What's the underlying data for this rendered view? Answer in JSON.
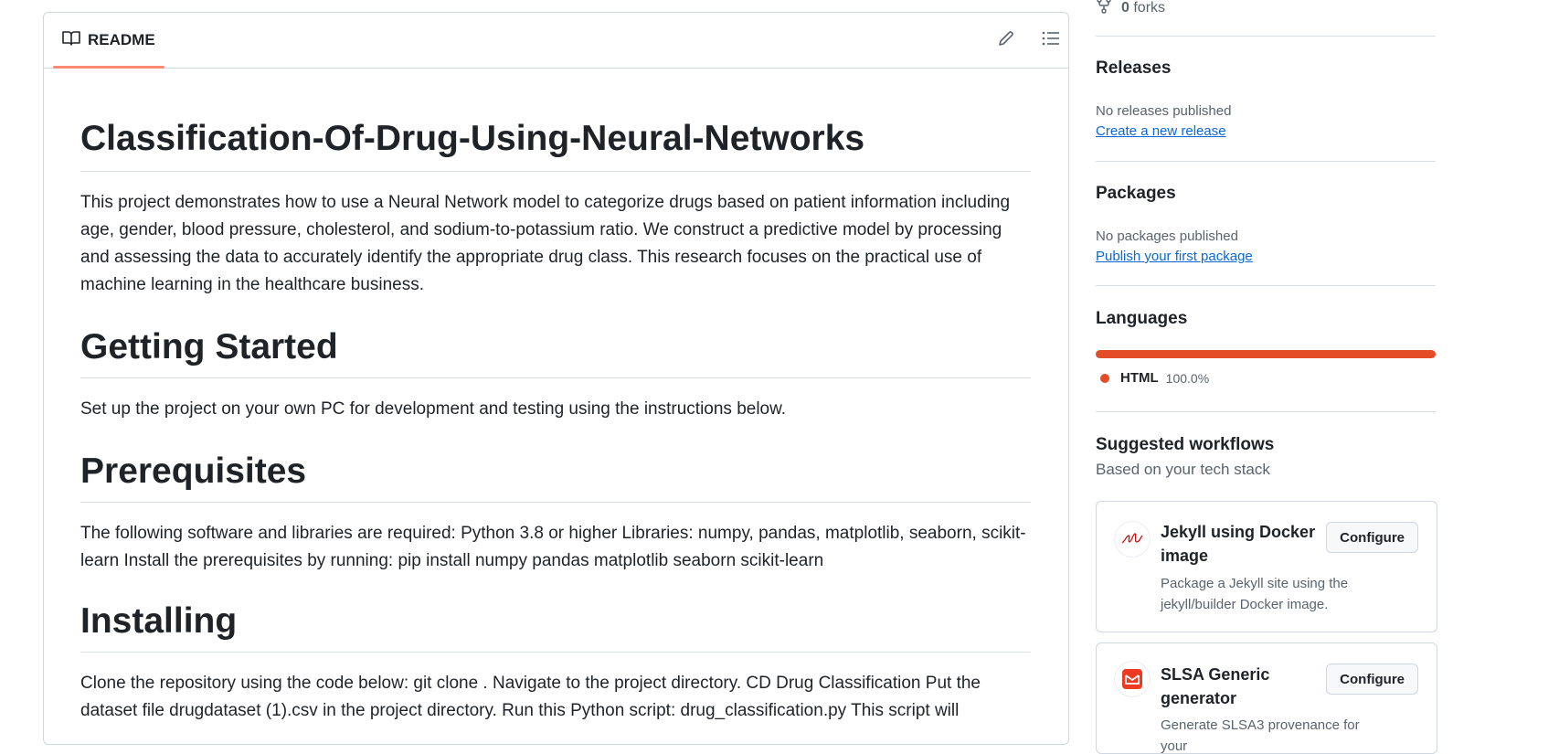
{
  "readme": {
    "tab_label": "README",
    "title": "Classification-Of-Drug-Using-Neural-Networks",
    "intro": "This project demonstrates how to use a Neural Network model to categorize drugs based on patient information including age, gender, blood pressure, cholesterol, and sodium-to-potassium ratio. We construct a predictive model by processing and assessing the data to accurately identify the appropriate drug class. This research focuses on the practical use of machine learning in the healthcare business.",
    "sections": [
      {
        "heading": "Getting Started",
        "text": "Set up the project on your own PC for development and testing using the instructions below."
      },
      {
        "heading": "Prerequisites",
        "text": "The following software and libraries are required: Python 3.8 or higher Libraries: numpy, pandas, matplotlib, seaborn, scikit-learn Install the prerequisites by running: pip install numpy pandas matplotlib seaborn scikit-learn"
      },
      {
        "heading": "Installing",
        "text": "Clone the repository using the code below: git clone . Navigate to the project directory. CD Drug Classification Put the dataset file drugdataset (1).csv in the project directory. Run this Python script: drug_classification.py This script will"
      }
    ]
  },
  "sidebar": {
    "forks_count": "0",
    "forks_label": "forks",
    "releases": {
      "heading": "Releases",
      "empty": "No releases published",
      "link": "Create a new release"
    },
    "packages": {
      "heading": "Packages",
      "empty": "No packages published",
      "link": "Publish your first package"
    },
    "languages": {
      "heading": "Languages",
      "items": [
        {
          "name": "HTML",
          "percent": "100.0%",
          "color": "#e34c26"
        }
      ]
    },
    "workflows": {
      "heading": "Suggested workflows",
      "subheading": "Based on your tech stack",
      "items": [
        {
          "title": "Jekyll using Docker image",
          "desc": "Package a Jekyll site using the jekyll/builder Docker image.",
          "button": "Configure"
        },
        {
          "title": "SLSA Generic generator",
          "desc": "Generate SLSA3 provenance for your",
          "button": "Configure"
        }
      ]
    }
  },
  "colors": {
    "accent_tab": "#fd8c73",
    "link": "#0969da",
    "html_lang": "#e34c26"
  }
}
